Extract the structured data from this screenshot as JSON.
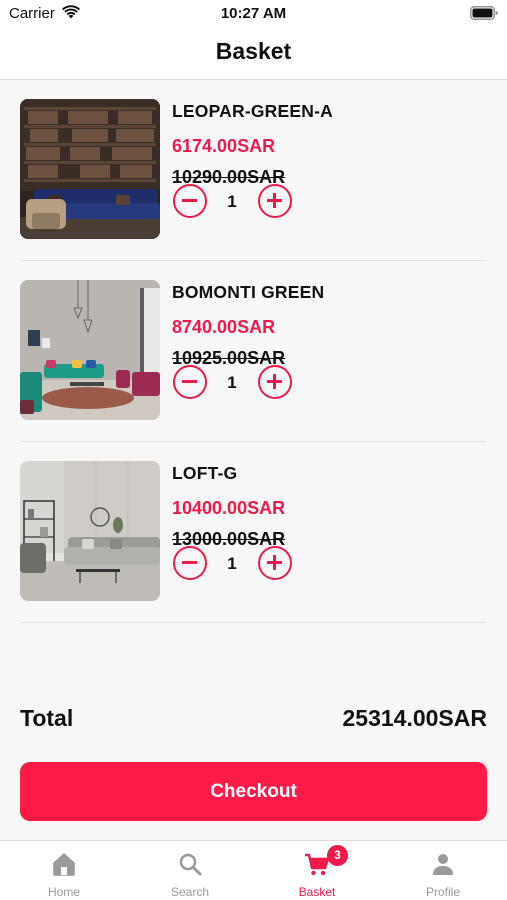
{
  "status_bar": {
    "carrier": "Carrier",
    "time": "10:27 AM",
    "wifi_icon": "wifi-icon",
    "battery_icon": "battery-icon"
  },
  "header": {
    "title": "Basket"
  },
  "items": [
    {
      "name": "LEOPAR-GREEN-A",
      "price": "6174.00SAR",
      "old_price": "10290.00SAR",
      "quantity": "1",
      "image": "library-room-blue-sofa-photo"
    },
    {
      "name": "BOMONTI GREEN",
      "price": "8740.00SAR",
      "old_price": "10925.00SAR",
      "quantity": "1",
      "image": "living-room-green-sofa-photo"
    },
    {
      "name": "LOFT-G",
      "price": "10400.00SAR",
      "old_price": "13000.00SAR",
      "quantity": "1",
      "image": "living-room-grey-sofa-photo"
    }
  ],
  "summary": {
    "total_label": "Total",
    "total_value": "25314.00SAR"
  },
  "checkout": {
    "label": "Checkout"
  },
  "tab_bar": {
    "tabs": [
      {
        "label": "Home",
        "icon": "home-icon"
      },
      {
        "label": "Search",
        "icon": "search-icon"
      },
      {
        "label": "Basket",
        "icon": "cart-icon",
        "badge": "3",
        "active": true
      },
      {
        "label": "Profile",
        "icon": "profile-icon"
      }
    ]
  },
  "colors": {
    "accent": "#ee1a4a",
    "checkout_button": "#ff1a47",
    "inactive_tab": "#9a9a9a",
    "background": "#f7f7f7"
  }
}
